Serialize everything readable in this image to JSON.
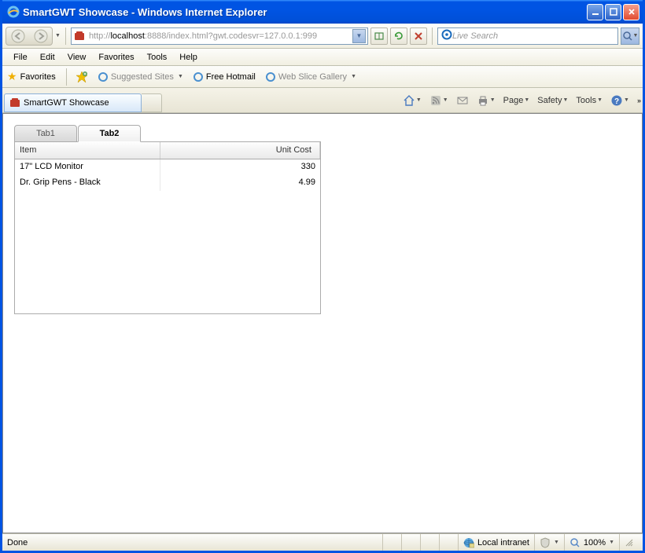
{
  "window": {
    "title": "SmartGWT Showcase - Windows Internet Explorer"
  },
  "address": {
    "prefix": "http://",
    "host": "localhost",
    "rest": ":8888/index.html?gwt.codesvr=127.0.0.1:999"
  },
  "search": {
    "placeholder": "Live Search"
  },
  "menu": {
    "file": "File",
    "edit": "Edit",
    "view": "View",
    "favorites": "Favorites",
    "tools": "Tools",
    "help": "Help"
  },
  "favbar": {
    "favorites": "Favorites",
    "suggested": "Suggested Sites",
    "hotmail": "Free Hotmail",
    "webslice": "Web Slice Gallery"
  },
  "page_tab": {
    "title": "SmartGWT Showcase"
  },
  "commands": {
    "page": "Page",
    "safety": "Safety",
    "tools": "Tools"
  },
  "tabs": {
    "tab1": "Tab1",
    "tab2": "Tab2"
  },
  "grid": {
    "headers": {
      "item": "Item",
      "unit_cost": "Unit Cost"
    },
    "rows": [
      {
        "item": "17\" LCD Monitor",
        "unit_cost": "330"
      },
      {
        "item": "Dr. Grip Pens - Black",
        "unit_cost": "4.99"
      }
    ]
  },
  "status": {
    "left": "Done",
    "zone": "Local intranet",
    "zoom": "100%"
  }
}
